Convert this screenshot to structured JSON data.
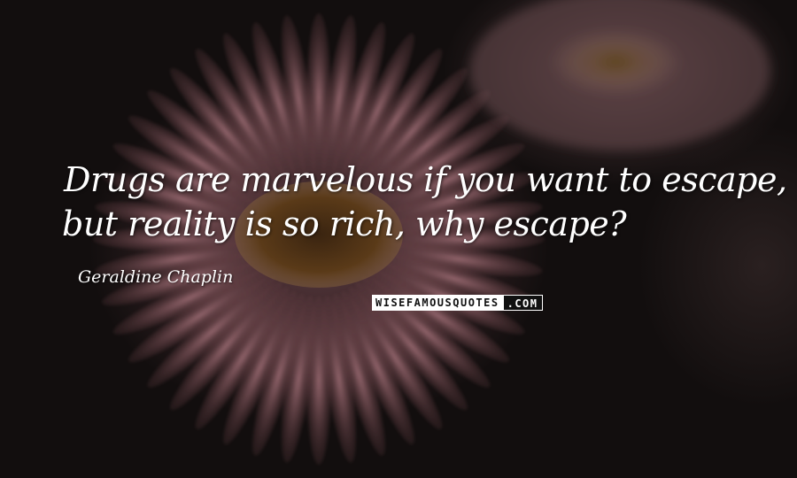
{
  "quote": {
    "line1": "Drugs are marvelous if you want to escape,",
    "line2": "but reality is so rich, why escape?"
  },
  "author": "Geraldine Chaplin",
  "watermark": {
    "main": "WISEFAMOUSQUOTES",
    "suffix": ".COM"
  },
  "colors": {
    "background": "#120e0e",
    "petals": "#8a5a60",
    "flower_center": "#5a3a1a",
    "text": "#ffffff"
  }
}
